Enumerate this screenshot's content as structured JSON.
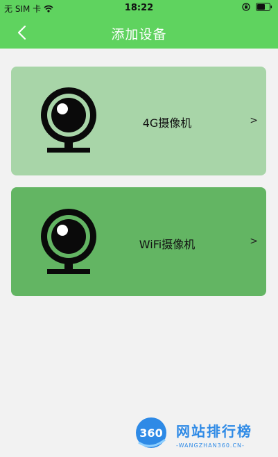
{
  "status_bar": {
    "carrier": "无 SIM 卡",
    "time": "18:22"
  },
  "nav": {
    "title": "添加设备"
  },
  "devices": [
    {
      "label": "4G摄像机",
      "arrow": ">",
      "icon": "webcam-icon"
    },
    {
      "label": "WiFi摄像机",
      "arrow": ">",
      "icon": "webcam-icon"
    }
  ],
  "watermark": {
    "badge_text": "360",
    "title": "网站排行榜",
    "subtitle": "-WANGZHAN360.CN-"
  },
  "colors": {
    "header": "#5fd35f",
    "card_4g": "#a8d5a8",
    "card_wifi": "#63b563",
    "background": "#f2f2f2",
    "watermark": "#2e8ae6"
  }
}
